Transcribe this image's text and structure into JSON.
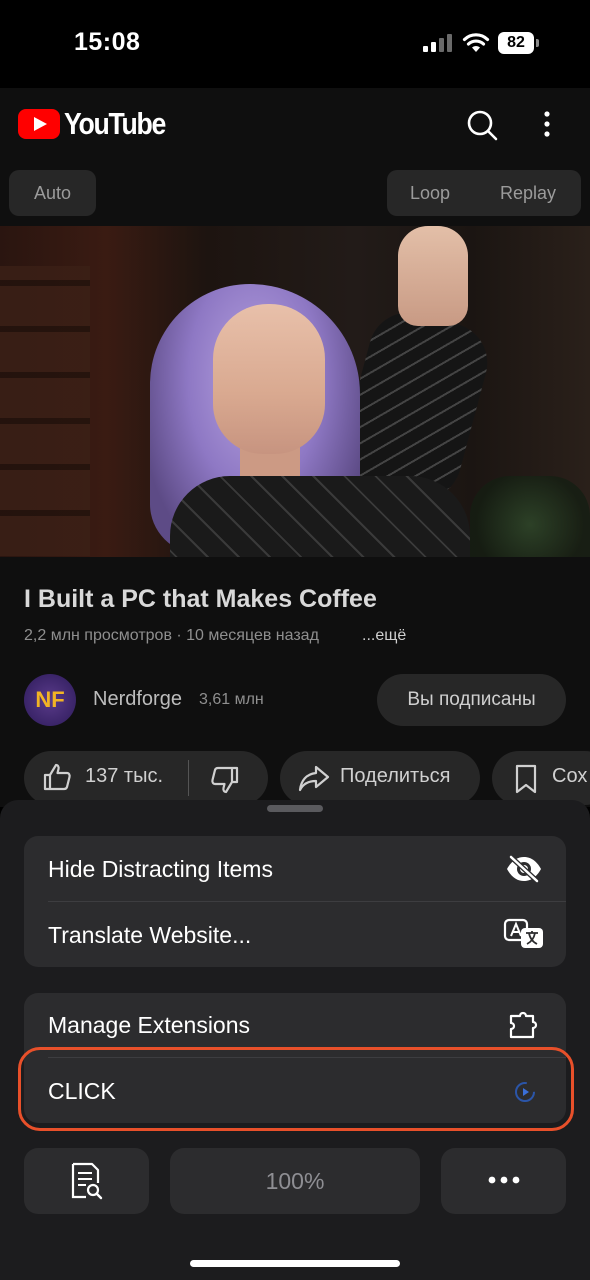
{
  "status_bar": {
    "time": "15:08",
    "battery": "82"
  },
  "youtube": {
    "logo_text": "YouTube",
    "controls": {
      "auto": "Auto",
      "loop": "Loop",
      "replay": "Replay"
    },
    "video": {
      "title": "I Built a PC that Makes Coffee",
      "meta": "2,2 млн просмотров · 10 месяцев назад",
      "more": "...ещё",
      "channel": "Nerdforge",
      "channel_subs": "3,61 млн",
      "avatar_glyph": "NF",
      "subscribe_label": "Вы подписаны",
      "likes": "137 тыс.",
      "share_label": "Поделиться",
      "save_label": "Сох"
    }
  },
  "sheet": {
    "group1": [
      {
        "label": "Hide Distracting Items",
        "icon": "eye-slash-icon"
      },
      {
        "label": "Translate Website...",
        "icon": "translate-icon"
      }
    ],
    "group2": [
      {
        "label": "Manage Extensions",
        "icon": "extension-icon"
      },
      {
        "label": "CLICK",
        "icon": "click-extension-icon"
      }
    ],
    "toolbar": {
      "zoom": "100%"
    },
    "highlight_color": "#e8502a"
  }
}
